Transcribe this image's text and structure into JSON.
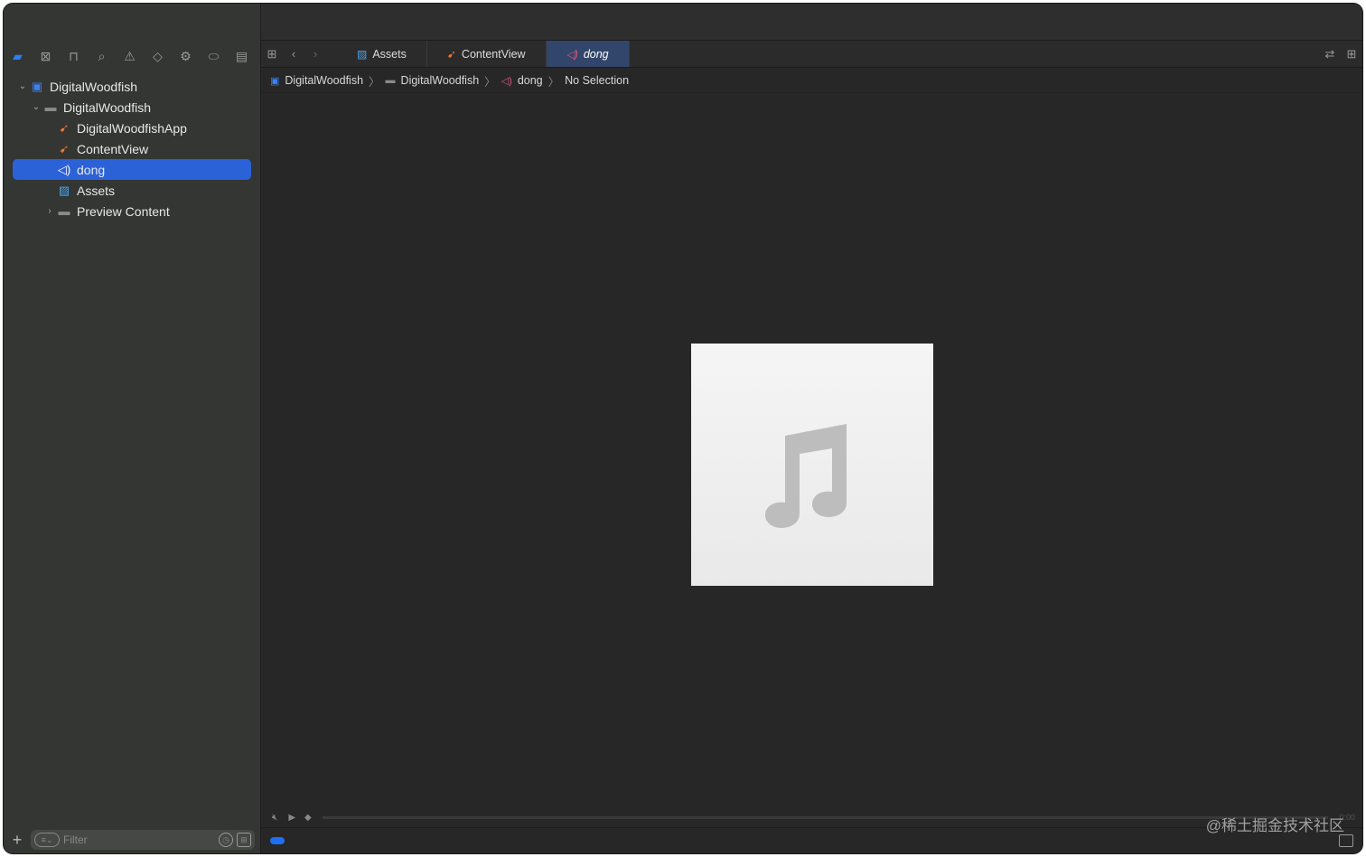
{
  "navigator": {
    "toolbar": [
      {
        "icon": "folder-icon",
        "glyph": "▰"
      },
      {
        "icon": "source-control-icon",
        "glyph": "⊠"
      },
      {
        "icon": "symbol-hierarchy-icon",
        "glyph": "⊓"
      },
      {
        "icon": "search-icon",
        "glyph": "⌕"
      },
      {
        "icon": "warning-icon",
        "glyph": "⚠"
      },
      {
        "icon": "test-diamond-icon",
        "glyph": "◇"
      },
      {
        "icon": "debug-icon",
        "glyph": "⚙"
      },
      {
        "icon": "breakpoint-icon",
        "glyph": "⬭"
      },
      {
        "icon": "report-icon",
        "glyph": "▤"
      }
    ],
    "tree": [
      {
        "label": "DigitalWoodfish",
        "icon": "xcode-project-icon",
        "level": 0,
        "disclosure": "expanded",
        "selected": false
      },
      {
        "label": "DigitalWoodfish",
        "icon": "folder-icon",
        "level": 1,
        "disclosure": "expanded",
        "selected": false
      },
      {
        "label": "DigitalWoodfishApp",
        "icon": "swift-file-icon",
        "level": 2,
        "disclosure": "none",
        "selected": false
      },
      {
        "label": "ContentView",
        "icon": "swift-file-icon",
        "level": 2,
        "disclosure": "none",
        "selected": false
      },
      {
        "label": "dong",
        "icon": "audio-file-icon",
        "level": 2,
        "disclosure": "none",
        "selected": true
      },
      {
        "label": "Assets",
        "icon": "asset-catalog-icon",
        "level": 2,
        "disclosure": "none",
        "selected": false
      },
      {
        "label": "Preview Content",
        "icon": "folder-icon",
        "level": 2,
        "disclosure": "collapsed",
        "selected": false
      }
    ],
    "filter_placeholder": "Filter"
  },
  "tabs": [
    {
      "label": "Assets",
      "icon": "asset-catalog-icon",
      "active": false
    },
    {
      "label": "ContentView",
      "icon": "swift-file-icon",
      "active": false
    },
    {
      "label": "dong",
      "icon": "audio-file-icon",
      "active": true
    }
  ],
  "breadcrumb": [
    {
      "label": "DigitalWoodfish",
      "icon": "xcode-project-icon"
    },
    {
      "label": "DigitalWoodfish",
      "icon": "folder-icon"
    },
    {
      "label": "dong",
      "icon": "audio-file-icon"
    },
    {
      "label": "No Selection",
      "icon": ""
    }
  ],
  "preview": {
    "icon": "music-note-icon"
  },
  "player": {
    "time": "0:00"
  },
  "watermark": "@稀土掘金技术社区",
  "colors": {
    "accent": "#2c62d8",
    "swift": "#f07a2d",
    "audio": "#d6577a",
    "project": "#3b82f6"
  }
}
